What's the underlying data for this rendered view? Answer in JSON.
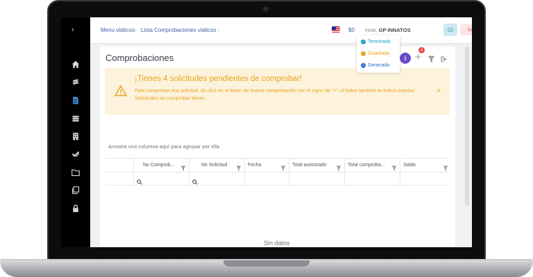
{
  "breadcrumb": {
    "items": [
      "Menu viáticos",
      "Lista Comprobaciones viáticos"
    ],
    "separator": "›"
  },
  "topbar": {
    "balance": "$0",
    "greeting": "Hola,",
    "user_name": "GP INNATOS",
    "avatar_initials": "GI",
    "logout_label": "Salir"
  },
  "page": {
    "title": "Comprobaciones",
    "add_badge_count": "4",
    "info_label": "i"
  },
  "status_popup": {
    "items": [
      {
        "label": "Terminada",
        "color": "#1fa0c8"
      },
      {
        "label": "Guardada",
        "color": "#e8a41c"
      },
      {
        "label": "Generada",
        "color": "#2c6fc9"
      }
    ]
  },
  "alert": {
    "title": "¡Tienes 4 solicitudes pendientes de comprobar!",
    "body": "Para comprobar una solicitud, da click en el boton de Nueva comprobación con el signo de \"+\", el boton tambien te indica cuantas Solicitudes sin comprobar tienes",
    "close": "×"
  },
  "grid": {
    "group_hint": "Arrastra una columna aquí para agrupar por ella",
    "columns": [
      "No Comprob...",
      "No Solicitud",
      "Fecha",
      "Total autorizado",
      "Total comproba...",
      "Saldo"
    ],
    "empty_text": "Sin datos"
  },
  "colors": {
    "accent": "#6c4cc9",
    "alert_bg": "#fdf3dc",
    "alert_text": "#e8a41c",
    "sidebar": "#000000",
    "logout_bg": "#fde4e4",
    "logout_text": "#e05a5a"
  },
  "icons": {
    "sidebar": [
      "home-icon",
      "layers-icon",
      "document-icon",
      "stack-icon",
      "building-icon",
      "check-icon",
      "folder-icon",
      "copy-icon",
      "lock-icon"
    ]
  }
}
